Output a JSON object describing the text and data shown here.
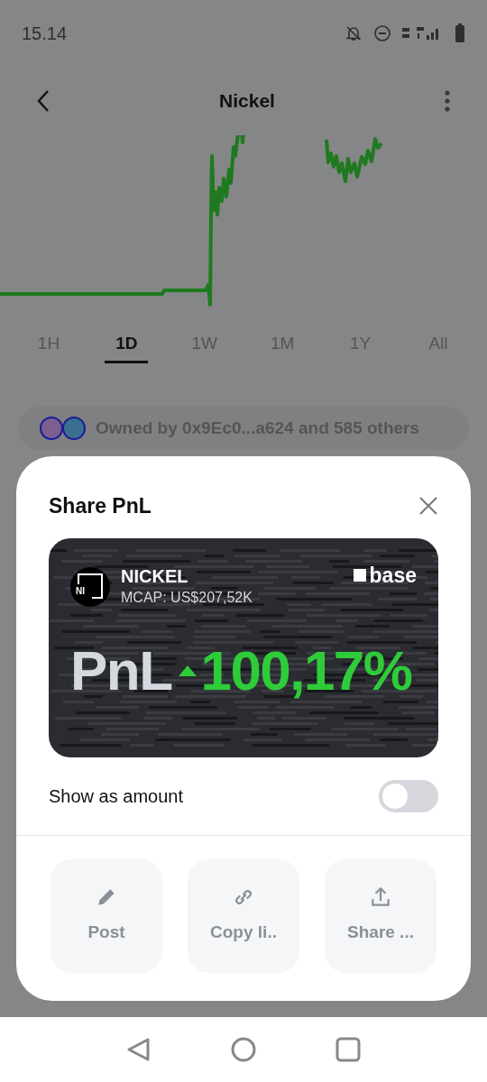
{
  "status_bar": {
    "time": "15.14"
  },
  "header": {
    "title": "Nickel"
  },
  "range_tabs": [
    {
      "label": "1H",
      "selected": false
    },
    {
      "label": "1D",
      "selected": true
    },
    {
      "label": "1W",
      "selected": false
    },
    {
      "label": "1M",
      "selected": false
    },
    {
      "label": "1Y",
      "selected": false
    },
    {
      "label": "All",
      "selected": false
    }
  ],
  "owners": {
    "text": "Owned by 0x9Ec0...a624 and 585 others"
  },
  "share_sheet": {
    "title": "Share PnL",
    "card": {
      "logo": "NI",
      "name": "NICKEL",
      "market_cap": "MCAP: US$207,52K",
      "network": "base",
      "pnl_label": "PnL",
      "pnl_value": "100,17%"
    },
    "show_as_amount": {
      "label": "Show as amount",
      "on": false
    },
    "actions": [
      {
        "kind": "pencil",
        "label": "Post"
      },
      {
        "kind": "link",
        "label": "Copy li.."
      },
      {
        "kind": "share",
        "label": "Share ..."
      }
    ]
  }
}
